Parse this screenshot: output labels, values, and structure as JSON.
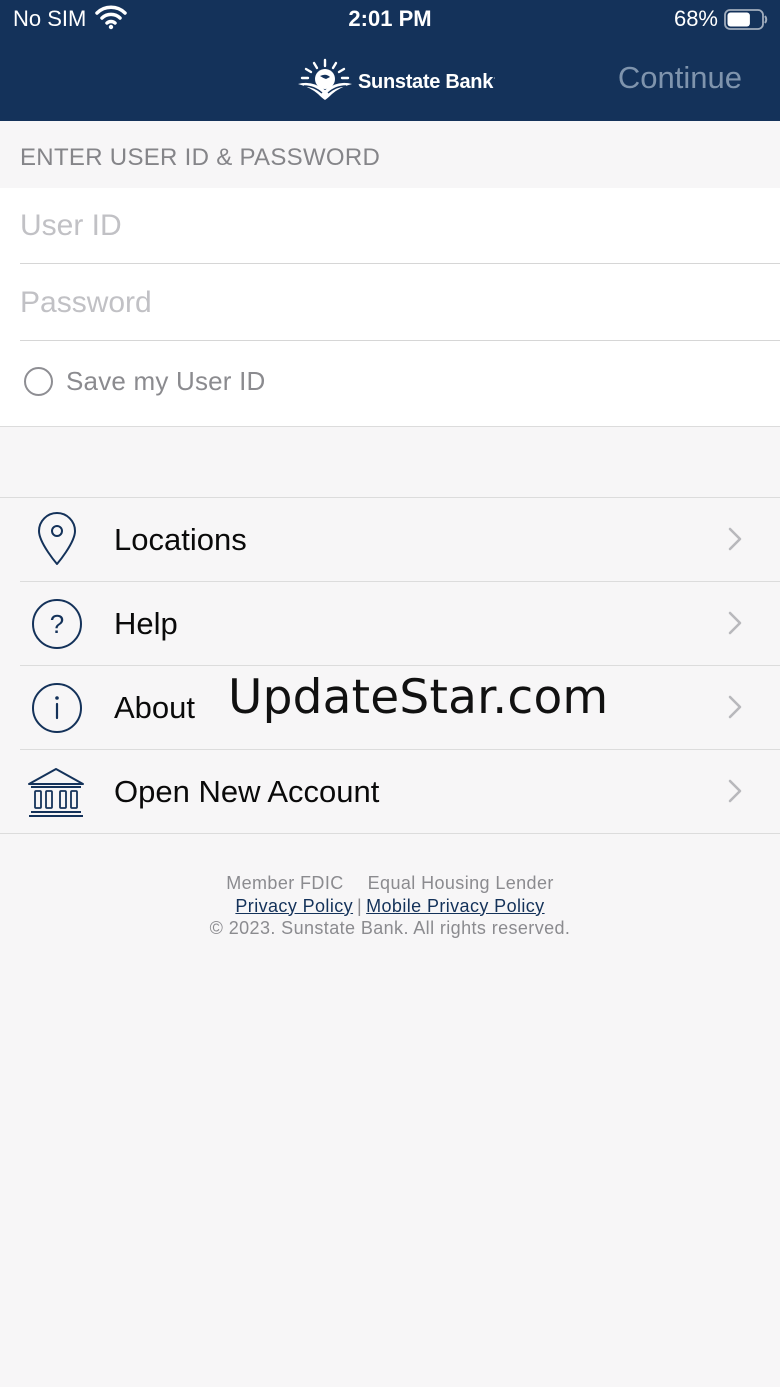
{
  "status_bar": {
    "carrier": "No SIM",
    "time": "2:01 PM",
    "battery_percent": "68%",
    "battery_level": 0.68
  },
  "header": {
    "logo_text": "Sunstate Bank",
    "logo_mark": "·",
    "continue_label": "Continue",
    "background_color": "#14325a"
  },
  "login": {
    "section_title": "ENTER USER ID & PASSWORD",
    "user_id_placeholder": "User ID",
    "user_id_value": "",
    "password_placeholder": "Password",
    "password_value": "",
    "save_user_id_label": "Save my User ID",
    "save_user_id_checked": false
  },
  "menu": {
    "items": [
      {
        "label": "Locations",
        "icon": "location-pin-icon"
      },
      {
        "label": "Help",
        "icon": "question-circle-icon"
      },
      {
        "label": "About",
        "icon": "info-circle-icon"
      },
      {
        "label": "Open New Account",
        "icon": "bank-building-icon"
      }
    ]
  },
  "watermark": "UpdateStar.com",
  "footer": {
    "member_fdic": "Member FDIC",
    "equal_housing": "Equal Housing Lender",
    "privacy_policy": "Privacy Policy",
    "separator": "|",
    "mobile_privacy_policy": "Mobile Privacy Policy",
    "copyright": "© 2023. Sunstate Bank. All rights reserved."
  }
}
